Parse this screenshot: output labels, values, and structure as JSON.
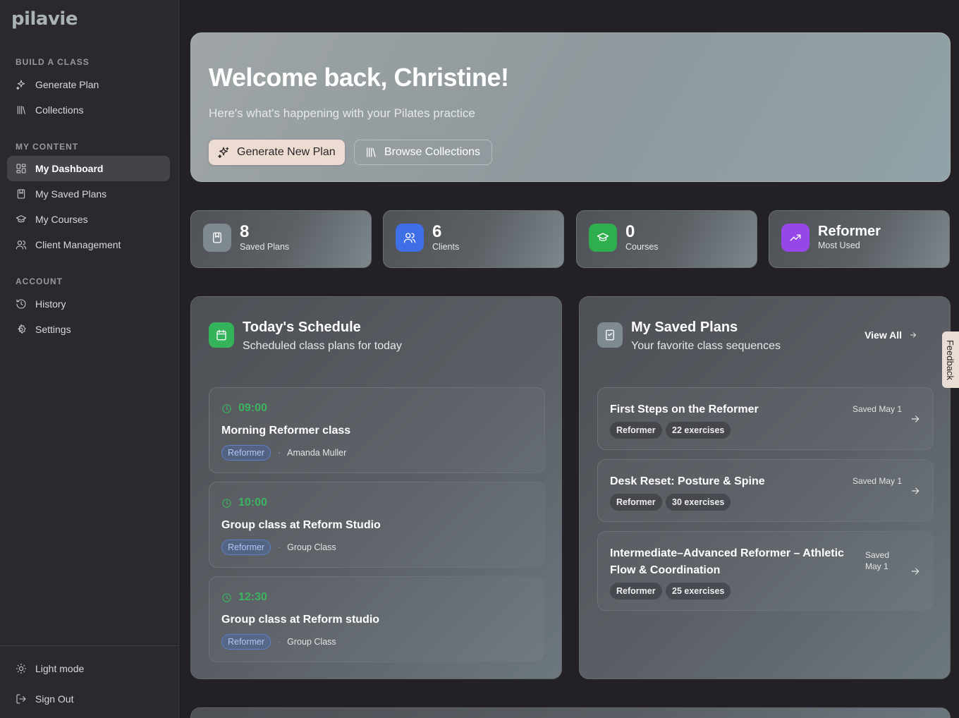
{
  "app": {
    "logo": "pilavie"
  },
  "sidebar": {
    "sections": [
      {
        "title": "BUILD A CLASS",
        "items": [
          {
            "label": "Generate Plan",
            "icon": "sparkles-icon"
          },
          {
            "label": "Collections",
            "icon": "library-icon"
          }
        ]
      },
      {
        "title": "MY CONTENT",
        "items": [
          {
            "label": "My Dashboard",
            "icon": "dashboard-icon",
            "active": true
          },
          {
            "label": "My Saved Plans",
            "icon": "bookmark-icon"
          },
          {
            "label": "My Courses",
            "icon": "graduation-cap-icon"
          },
          {
            "label": "Client Management",
            "icon": "users-icon"
          }
        ]
      },
      {
        "title": "ACCOUNT",
        "items": [
          {
            "label": "History",
            "icon": "history-icon"
          },
          {
            "label": "Settings",
            "icon": "gear-icon"
          }
        ]
      }
    ],
    "footer": [
      {
        "label": "Light mode",
        "icon": "sun-icon"
      },
      {
        "label": "Sign Out",
        "icon": "sign-out-icon"
      }
    ]
  },
  "hero": {
    "title": "Welcome back, Christine!",
    "subtitle": "Here's what's happening with your Pilates practice",
    "primary_button": "Generate New Plan",
    "secondary_button": "Browse Collections"
  },
  "stats": [
    {
      "value": "8",
      "label": "Saved Plans",
      "icon": "bookmark-icon",
      "color": "#7E8A90"
    },
    {
      "value": "6",
      "label": "Clients",
      "icon": "users-icon",
      "color": "#3F6FE6"
    },
    {
      "value": "0",
      "label": "Courses",
      "icon": "graduation-cap-icon",
      "color": "#2FAE4E"
    },
    {
      "value": "Reformer",
      "label": "Most Used",
      "icon": "trending-up-icon",
      "color": "#9747E8"
    }
  ],
  "schedule": {
    "title": "Today's Schedule",
    "subtitle": "Scheduled class plans for today",
    "icon_color": "#34B35A",
    "items": [
      {
        "time": "09:00",
        "name": "Morning Reformer class",
        "tag": "Reformer",
        "meta": "Amanda Muller"
      },
      {
        "time": "10:00",
        "name": "Group class at Reform Studio",
        "tag": "Reformer",
        "meta": "Group Class"
      },
      {
        "time": "12:30",
        "name": "Group class at Reform studio",
        "tag": "Reformer",
        "meta": "Group Class"
      }
    ]
  },
  "saved_plans": {
    "title": "My Saved Plans",
    "subtitle": "Your favorite class sequences",
    "view_all": "View All",
    "items": [
      {
        "title": "First Steps on the Reformer",
        "date": "Saved May 1",
        "tag": "Reformer",
        "count": "22 exercises"
      },
      {
        "title": "Desk Reset: Posture & Spine",
        "date": "Saved May 1",
        "tag": "Reformer",
        "count": "30 exercises"
      },
      {
        "title_line1": "Intermediate–Advanced Reformer – Athletic",
        "title_line2": "Flow & Coordination",
        "date_line1": "Saved",
        "date_line2": "May 1",
        "tag": "Reformer",
        "count": "25 exercises"
      }
    ]
  },
  "feedback": {
    "label": "Feedback"
  }
}
